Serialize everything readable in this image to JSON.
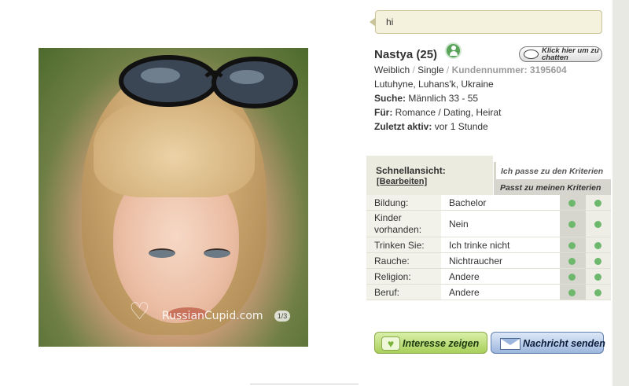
{
  "message": {
    "text": "hi"
  },
  "profile": {
    "name": "Nastya (25)",
    "gender": "Weiblich",
    "status": "Single",
    "customer_label": "Kundennummer:",
    "customer_number": "3195604",
    "location": "Lutuhyne, Luhans'k, Ukraine",
    "search_label": "Suche:",
    "search_value": "Männlich 33 - 55",
    "for_label": "Für:",
    "for_value": "Romance / Dating, Heirat",
    "last_active_label": "Zuletzt aktiv:",
    "last_active_value": "vor 1 Stunde",
    "online_icon": "person-online-icon"
  },
  "photo": {
    "watermark": "RussianCupid.com",
    "photo_count": "1/3"
  },
  "chat_button": {
    "label": "Klick hier um zu chatten"
  },
  "quickview": {
    "title": "Schnellansicht:",
    "edit_label": "[Bearbeiten]",
    "criteria_me": "Ich passe zu den Kriterien",
    "criteria_them": "Passt zu meinen Kriterien",
    "rows": [
      {
        "key": "Bildung:",
        "value": "Bachelor",
        "match_me": true,
        "match_them": true
      },
      {
        "key": "Kinder vorhanden:",
        "value": "Nein",
        "match_me": true,
        "match_them": true
      },
      {
        "key": "Trinken Sie:",
        "value": "Ich trinke nicht",
        "match_me": true,
        "match_them": true
      },
      {
        "key": "Rauche:",
        "value": "Nichtraucher",
        "match_me": true,
        "match_them": true
      },
      {
        "key": "Religion:",
        "value": "Andere",
        "match_me": true,
        "match_them": true
      },
      {
        "key": "Beruf:",
        "value": "Andere",
        "match_me": true,
        "match_them": true
      }
    ]
  },
  "actions": {
    "interest_label": "Interesse zeigen",
    "message_label": "Nachricht senden"
  },
  "colors": {
    "match_dot": "#6eb86e",
    "interest_button": "#a9cf5b",
    "message_button": "#9db6dd"
  }
}
